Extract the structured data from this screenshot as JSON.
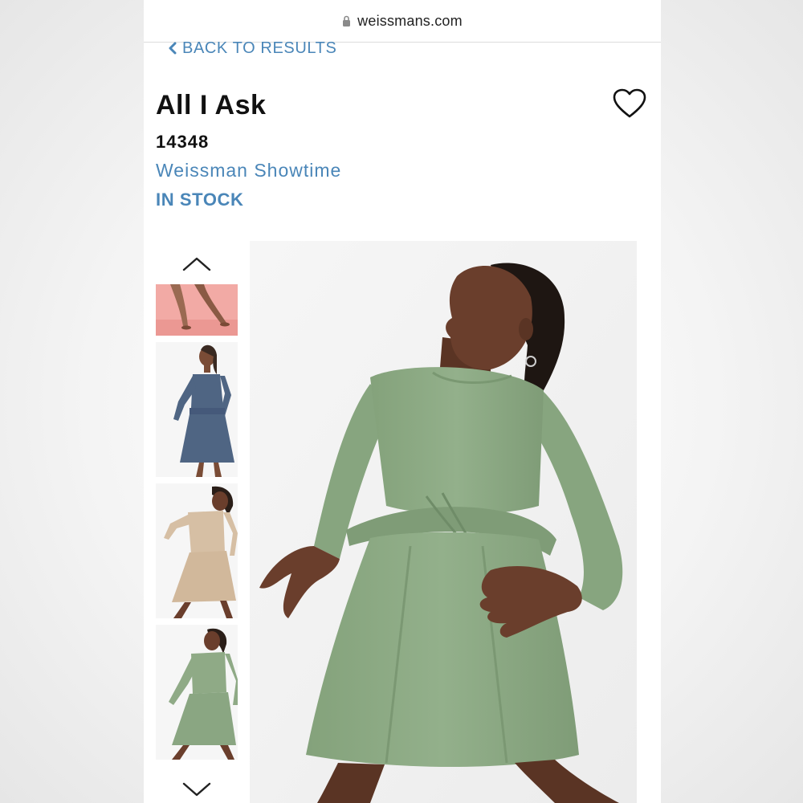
{
  "browser": {
    "url": "weissmans.com",
    "lock_icon": "lock-icon"
  },
  "nav": {
    "back_label": "BACK TO RESULTS",
    "back_icon": "chevron-left-icon"
  },
  "product": {
    "title": "All I Ask",
    "sku": "14348",
    "brand": "Weissman Showtime",
    "stock_status": "IN STOCK",
    "favorite_icon": "heart-icon"
  },
  "gallery": {
    "up_icon": "chevron-up-icon",
    "down_icon": "chevron-down-icon",
    "thumbnails": [
      {
        "alt": "pink background legs thumbnail",
        "color": "#f2aaa5"
      },
      {
        "alt": "navy blue dress thumbnail",
        "color": "#4f6583"
      },
      {
        "alt": "beige dress thumbnail",
        "color": "#d6bfa4"
      },
      {
        "alt": "sage green dress thumbnail",
        "color": "#8faa86"
      }
    ],
    "main_image": {
      "alt": "dancer in sage green long-sleeve dress",
      "color": "#8fab88"
    }
  },
  "colors": {
    "accent": "#4a86b8",
    "text": "#111111"
  }
}
